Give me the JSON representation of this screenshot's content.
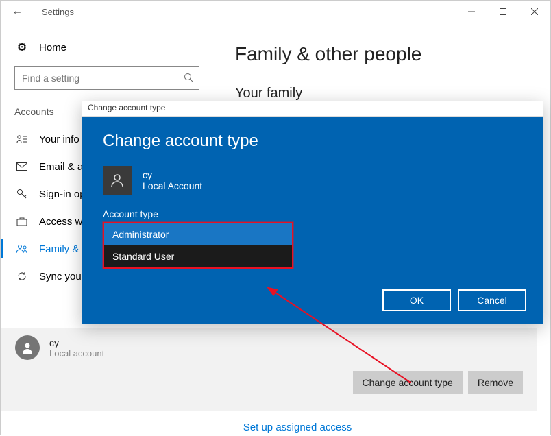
{
  "window": {
    "title": "Settings"
  },
  "sidebar": {
    "home_label": "Home",
    "search_placeholder": "Find a setting",
    "section_label": "Accounts",
    "items": [
      {
        "label": "Your info"
      },
      {
        "label": "Email & app"
      },
      {
        "label": "Sign-in op"
      },
      {
        "label": "Access wo"
      },
      {
        "label": "Family & o"
      },
      {
        "label": "Sync your"
      }
    ]
  },
  "content": {
    "heading": "Family & other people",
    "subheading": "Your family",
    "user": {
      "name": "cy",
      "type": "Local account"
    },
    "change_btn": "Change account type",
    "remove_btn": "Remove",
    "setup_link": "Set up assigned access"
  },
  "modal": {
    "titlebar": "Change account type",
    "heading": "Change account type",
    "user": {
      "name": "cy",
      "type": "Local Account"
    },
    "field_label": "Account type",
    "options": [
      "Administrator",
      "Standard User"
    ],
    "selected_index": 0,
    "ok_label": "OK",
    "cancel_label": "Cancel"
  }
}
